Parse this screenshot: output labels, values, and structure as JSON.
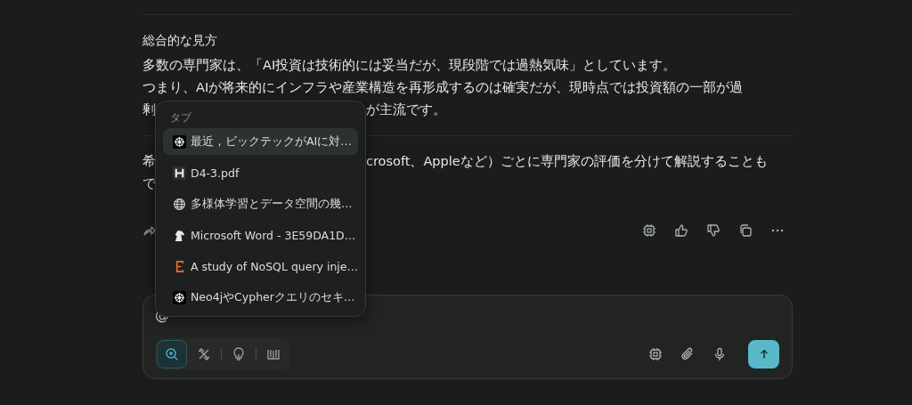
{
  "message": {
    "heading": "総合的な見方",
    "lines": [
      {
        "left": "多数の専門家は、「AI投資は技術的には妥当だが、現段階では過熱気味」としています。"
      },
      {
        "left": "つまり、AIが将来的にインフラや産業構造を再形成するのは確実だが、現時点では投資額の一部が過"
      },
      {
        "left": "剰",
        "right": "が主流です。"
      }
    ],
    "lines2": [
      {
        "left": "希",
        "right": "crosoft、Appleなど）ごとに専門家の評価を分けて解説することも"
      },
      {
        "left": "で"
      }
    ]
  },
  "mention_popup": {
    "section": "タブ",
    "items": [
      {
        "kind": "emblem",
        "label": "最近，ビックテックがAIに対…",
        "selected": true
      },
      {
        "kind": "h",
        "label": "D4-3.pdf",
        "selected": false
      },
      {
        "kind": "globe",
        "label": "多様体学習とデータ空間の幾…",
        "selected": false
      },
      {
        "kind": "horse",
        "label": "Microsoft Word - 3E59DA1D…",
        "selected": false
      },
      {
        "kind": "e",
        "label": "A study of NoSQL query inje…",
        "selected": false
      },
      {
        "kind": "emblem",
        "label": "Neo4jやCypherクエリのセキ…",
        "selected": false
      }
    ]
  },
  "composer": {
    "value": "@",
    "tools": [
      {
        "kind": "search",
        "selected": true
      },
      {
        "kind": "link",
        "selected": false
      },
      {
        "kind": "bulb",
        "selected": false
      },
      {
        "kind": "book",
        "selected": false
      }
    ]
  }
}
